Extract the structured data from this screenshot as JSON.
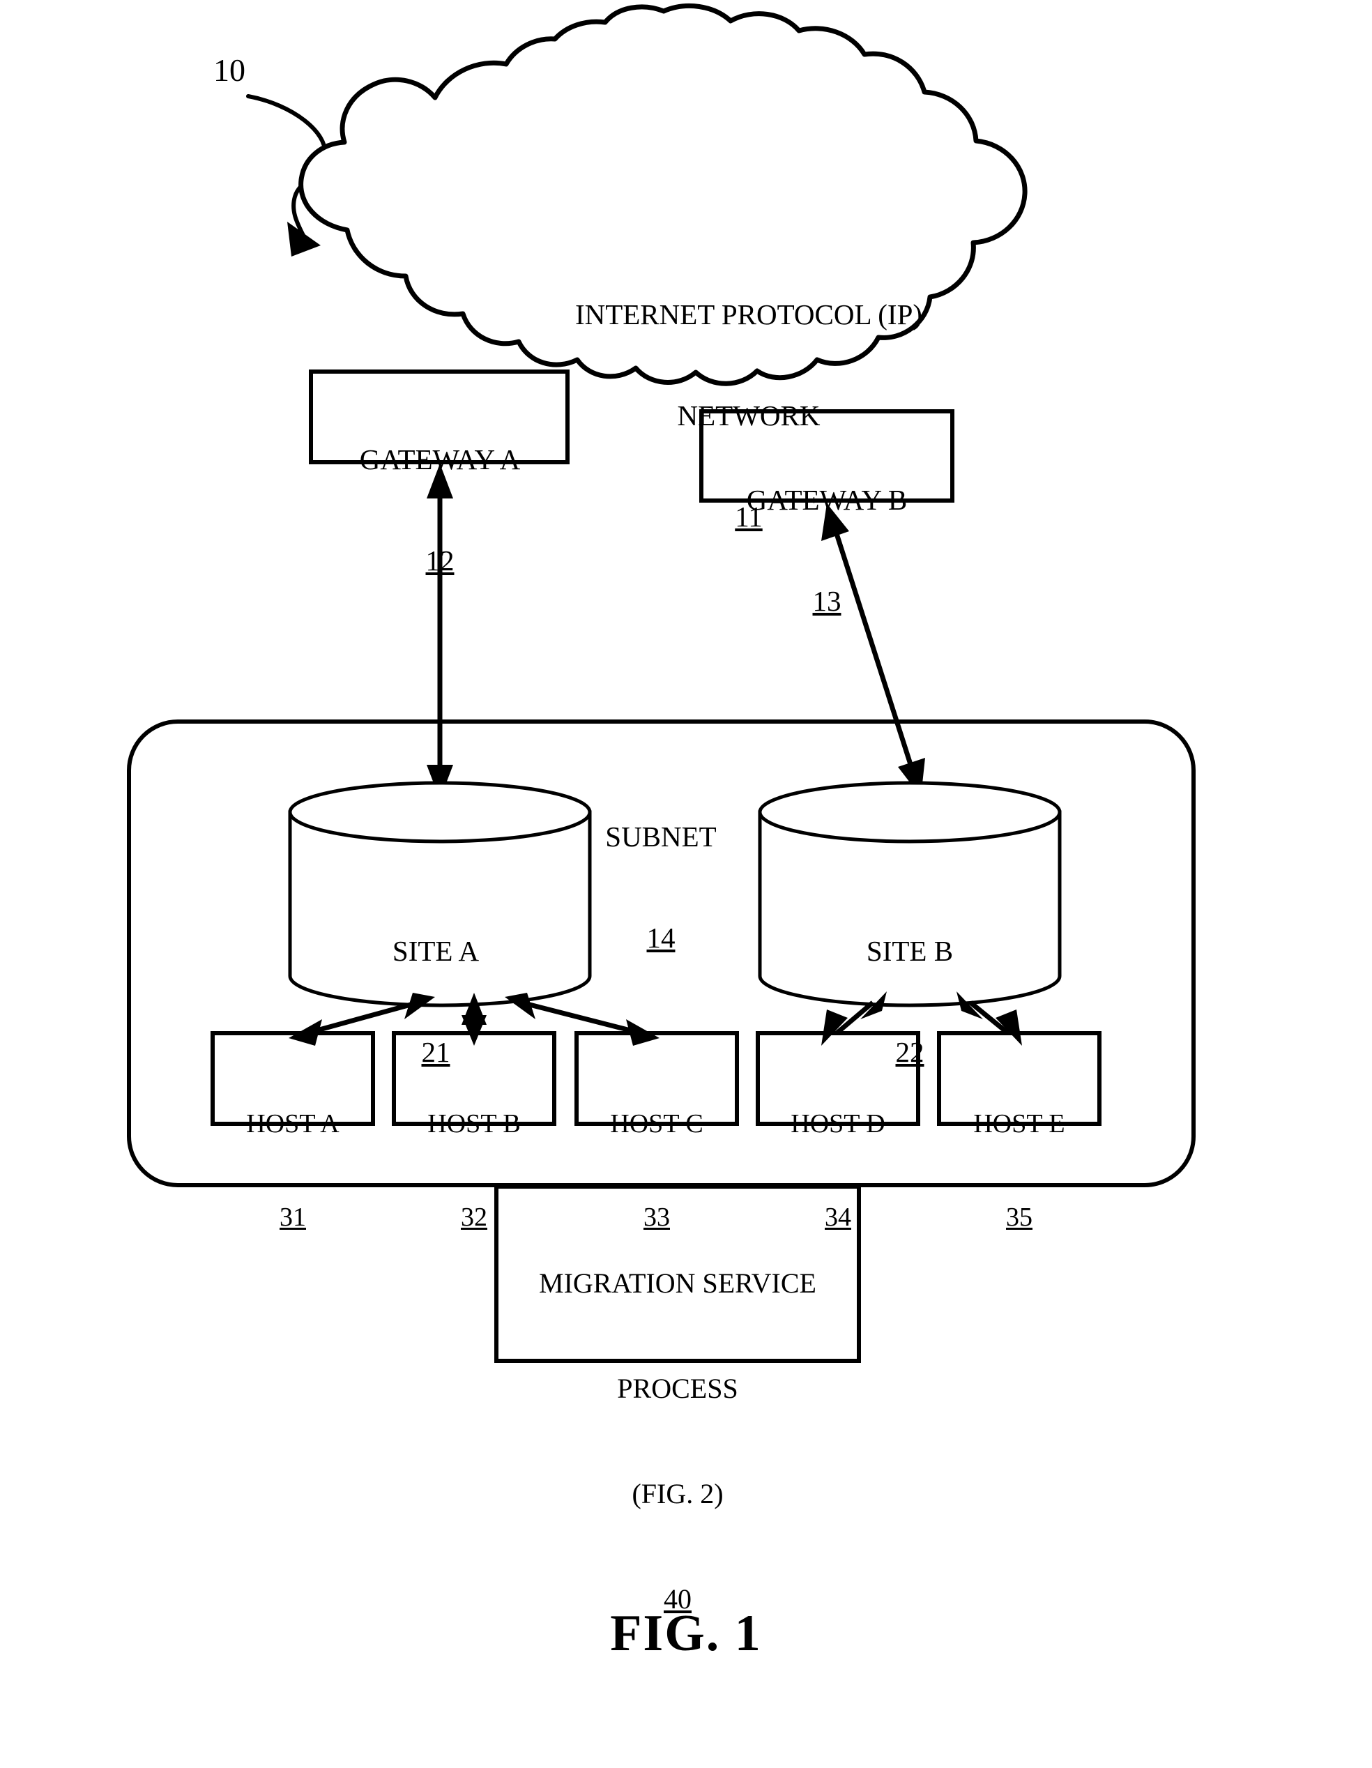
{
  "figure": {
    "caption": "FIG. 1",
    "system_ref": "10"
  },
  "network_cloud": {
    "name": "cloud-shape",
    "line1": "INTERNET PROTOCOL (IP)",
    "line2": "NETWORK",
    "ref": "11"
  },
  "gateways": [
    {
      "label": "GATEWAY A",
      "ref": "12"
    },
    {
      "label": "GATEWAY B",
      "ref": "13"
    }
  ],
  "subnet": {
    "label": "SUBNET",
    "ref": "14"
  },
  "sites": [
    {
      "label": "SITE A",
      "ref": "21"
    },
    {
      "label": "SITE B",
      "ref": "22"
    }
  ],
  "hosts": [
    {
      "label": "HOST A",
      "ref": "31"
    },
    {
      "label": "HOST B",
      "ref": "32"
    },
    {
      "label": "HOST C",
      "ref": "33"
    },
    {
      "label": "HOST D",
      "ref": "34"
    },
    {
      "label": "HOST E",
      "ref": "35"
    }
  ],
  "migration_service": {
    "line1": "MIGRATION SERVICE",
    "line2": "PROCESS",
    "line3": "(FIG. 2)",
    "ref": "40"
  },
  "colors": {
    "ink": "#000000",
    "paper": "#ffffff"
  }
}
